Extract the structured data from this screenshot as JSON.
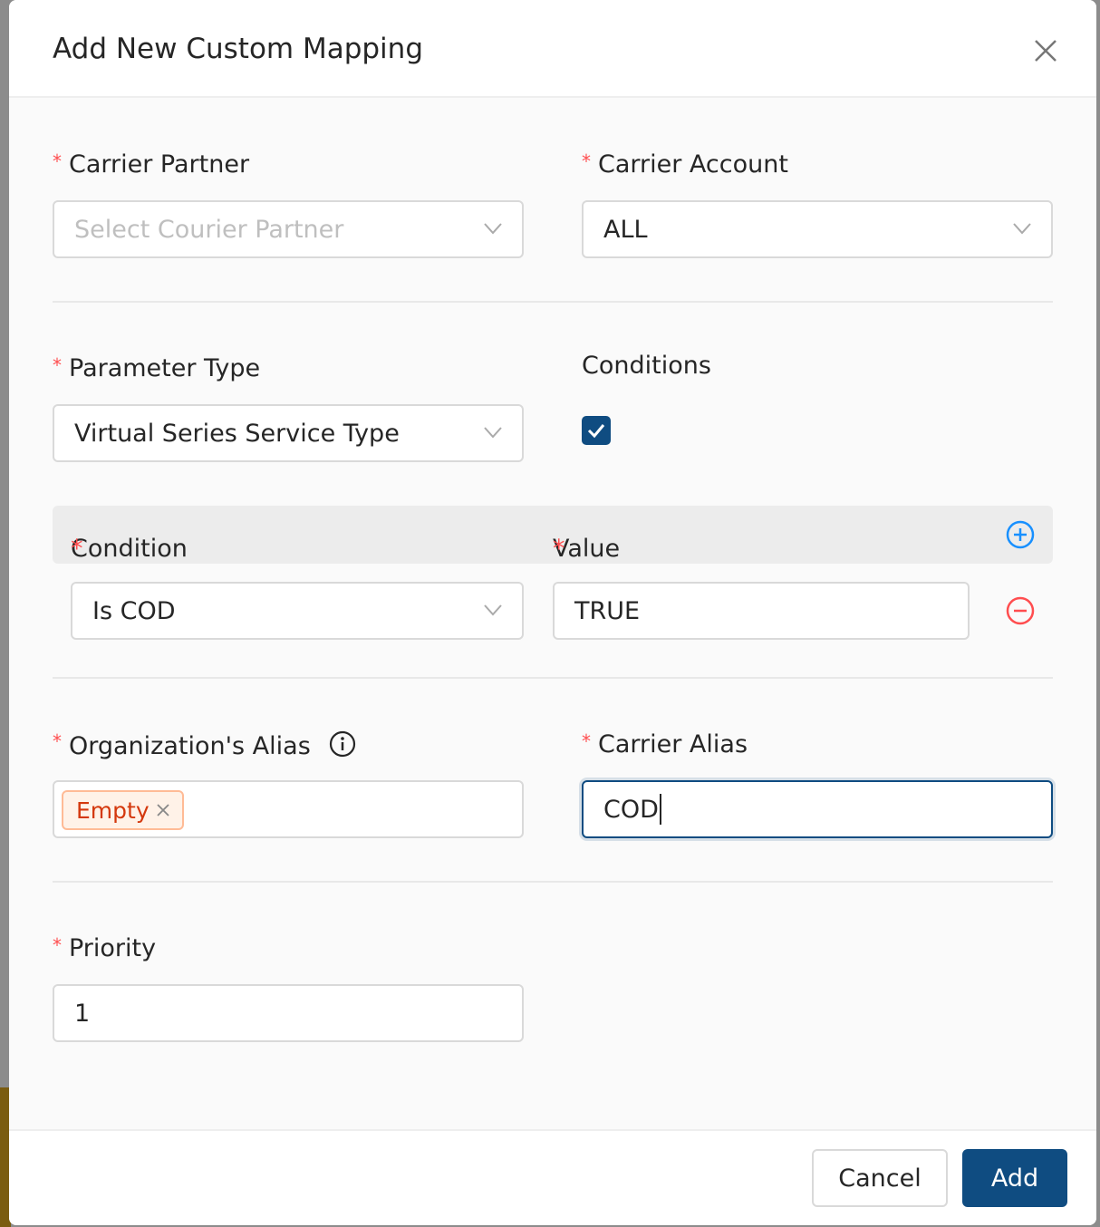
{
  "dialog": {
    "title": "Add New Custom Mapping"
  },
  "carrier_partner": {
    "label": "Carrier Partner",
    "placeholder": "Select Courier Partner"
  },
  "carrier_account": {
    "label": "Carrier Account",
    "value": "ALL"
  },
  "parameter_type": {
    "label": "Parameter Type",
    "value": "Virtual Series Service Type"
  },
  "conditions": {
    "label": "Conditions",
    "checked": true
  },
  "condition_table": {
    "condition_header": "Condition",
    "value_header": "Value",
    "rows": [
      {
        "condition": "Is COD",
        "value": "TRUE"
      }
    ]
  },
  "org_alias": {
    "label": "Organization's Alias",
    "tags": [
      "Empty"
    ]
  },
  "carrier_alias": {
    "label": "Carrier Alias",
    "value": "COD"
  },
  "priority": {
    "label": "Priority",
    "value": "1"
  },
  "footer": {
    "cancel": "Cancel",
    "add": "Add"
  },
  "colors": {
    "primary": "#0f4c81",
    "required": "#ff4d4f",
    "add_circle": "#1890ff",
    "remove_circle": "#ff4d4f"
  }
}
